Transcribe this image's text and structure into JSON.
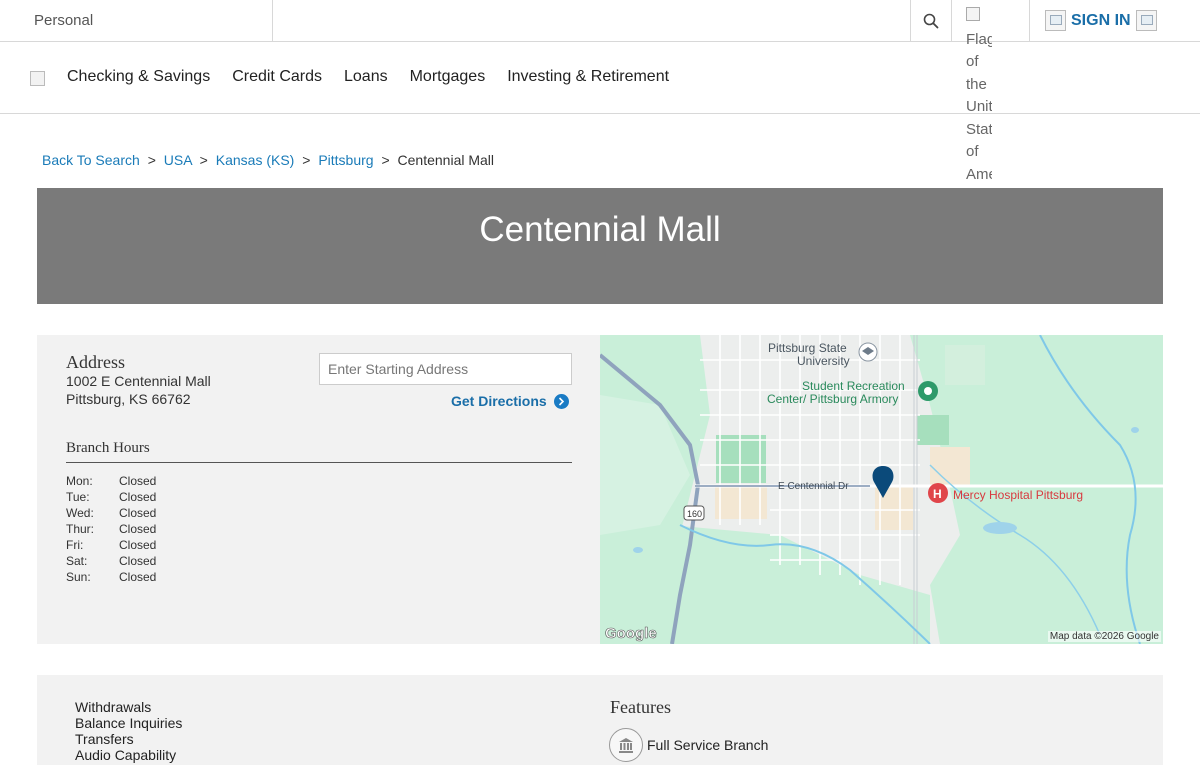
{
  "topbar": {
    "personal_label": "Personal",
    "flag_alt": [
      "Flag",
      "of",
      "the",
      "United",
      "States",
      "of",
      "America"
    ],
    "sign_in_label": "SIGN IN"
  },
  "nav": {
    "items": [
      "Checking & Savings",
      "Credit Cards",
      "Loans",
      "Mortgages",
      "Investing & Retirement"
    ]
  },
  "breadcrumb": {
    "back": "Back To Search",
    "country": "USA",
    "state": "Kansas (KS)",
    "city": "Pittsburg",
    "current": "Centennial Mall",
    "separator": ">"
  },
  "hero": {
    "title": "Centennial Mall"
  },
  "address": {
    "heading": "Address",
    "line1": "1002 E Centennial Mall",
    "line2": "Pittsburg, KS 66762"
  },
  "directions": {
    "placeholder": "Enter Starting Address",
    "button_label": "Get Directions"
  },
  "hours": {
    "heading": "Branch Hours",
    "rows": [
      {
        "day": "Mon:",
        "status": "Closed"
      },
      {
        "day": "Tue:",
        "status": "Closed"
      },
      {
        "day": "Wed:",
        "status": "Closed"
      },
      {
        "day": "Thur:",
        "status": "Closed"
      },
      {
        "day": "Fri:",
        "status": "Closed"
      },
      {
        "day": "Sat:",
        "status": "Closed"
      },
      {
        "day": "Sun:",
        "status": "Closed"
      }
    ]
  },
  "map": {
    "labels": {
      "university": "Pittsburg State",
      "university2": "University",
      "rec_center": "Student Recreation",
      "rec_center2": "Center/ Pittsburg Armory",
      "street": "E Centennial Dr",
      "hospital": "Mercy Hospital Pittsburg",
      "highway": "160",
      "google": "Google",
      "attribution": "Map data ©2026 Google"
    },
    "colors": {
      "pin": "#0b4a7a",
      "hospital": "#e0454a",
      "park": "#2e9a6a"
    }
  },
  "services": {
    "items": [
      "Withdrawals",
      "Balance Inquiries",
      "Transfers",
      "Audio Capability"
    ],
    "features_heading": "Features",
    "features": [
      "Full Service Branch"
    ]
  },
  "colors": {
    "link": "#1a7bb8",
    "hero_bg": "#7a7a7a",
    "panel_bg": "#f2f2f2"
  }
}
